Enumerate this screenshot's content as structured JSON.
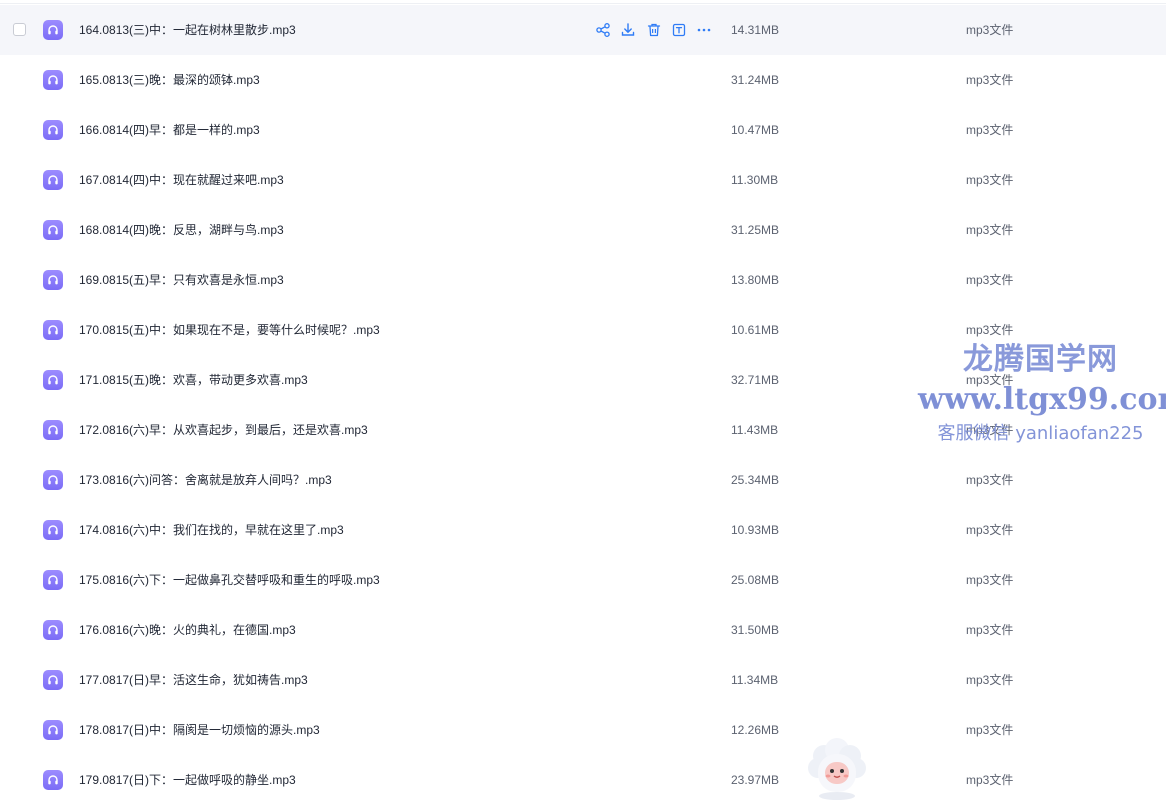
{
  "files": [
    {
      "name": "164.0813(三)中：一起在树林里散步.mp3",
      "size": "14.31MB",
      "type": "mp3文件"
    },
    {
      "name": "165.0813(三)晚：最深的颂钵.mp3",
      "size": "31.24MB",
      "type": "mp3文件"
    },
    {
      "name": "166.0814(四)早：都是一样的.mp3",
      "size": "10.47MB",
      "type": "mp3文件"
    },
    {
      "name": "167.0814(四)中：现在就醒过来吧.mp3",
      "size": "11.30MB",
      "type": "mp3文件"
    },
    {
      "name": "168.0814(四)晚：反思，湖畔与鸟.mp3",
      "size": "31.25MB",
      "type": "mp3文件"
    },
    {
      "name": "169.0815(五)早：只有欢喜是永恒.mp3",
      "size": "13.80MB",
      "type": "mp3文件"
    },
    {
      "name": "170.0815(五)中：如果现在不是，要等什么时候呢？.mp3",
      "size": "10.61MB",
      "type": "mp3文件"
    },
    {
      "name": "171.0815(五)晚：欢喜，带动更多欢喜.mp3",
      "size": "32.71MB",
      "type": "mp3文件"
    },
    {
      "name": "172.0816(六)早：从欢喜起步，到最后，还是欢喜.mp3",
      "size": "11.43MB",
      "type": "mp3文件"
    },
    {
      "name": "173.0816(六)问答：舍离就是放弃人间吗？.mp3",
      "size": "25.34MB",
      "type": "mp3文件"
    },
    {
      "name": "174.0816(六)中：我们在找的，早就在这里了.mp3",
      "size": "10.93MB",
      "type": "mp3文件"
    },
    {
      "name": "175.0816(六)下：一起做鼻孔交替呼吸和重生的呼吸.mp3",
      "size": "25.08MB",
      "type": "mp3文件"
    },
    {
      "name": "176.0816(六)晚：火的典礼，在德国.mp3",
      "size": "31.50MB",
      "type": "mp3文件"
    },
    {
      "name": "177.0817(日)早：活这生命，犹如祷告.mp3",
      "size": "11.34MB",
      "type": "mp3文件"
    },
    {
      "name": "178.0817(日)中：隔阂是一切烦恼的源头.mp3",
      "size": "12.26MB",
      "type": "mp3文件"
    },
    {
      "name": "179.0817(日)下：一起做呼吸的静坐.mp3",
      "size": "23.97MB",
      "type": "mp3文件"
    }
  ],
  "row_actions": [
    "share-icon",
    "download-icon",
    "delete-icon",
    "text-extract-icon",
    "more-icon"
  ],
  "file_icon": "audio-headphones-icon",
  "watermark": {
    "title": "龙腾国学网",
    "url": "www.ltgx99.com",
    "contact": "客服微信 yanliaofan225"
  },
  "colors": {
    "accent": "#2f7cf6",
    "file_icon": "#7b6cf6",
    "hover_row": "#f5f6fa",
    "watermark": "#7d8fd6"
  }
}
